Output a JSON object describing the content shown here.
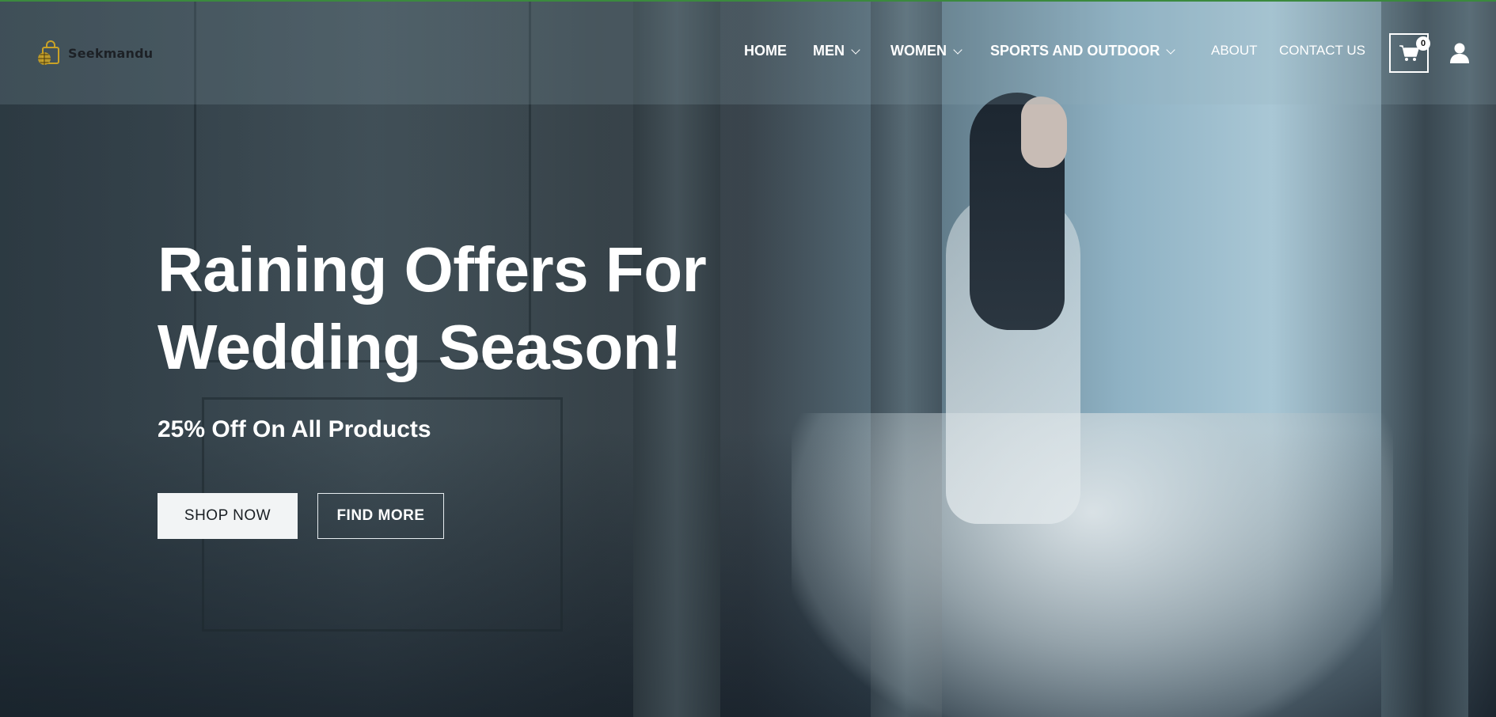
{
  "brand": {
    "name": "Seekmandu"
  },
  "nav": {
    "items": [
      {
        "label": "HOME",
        "dropdown": false
      },
      {
        "label": "MEN",
        "dropdown": true
      },
      {
        "label": "WOMEN",
        "dropdown": true
      },
      {
        "label": "SPORTS AND OUTDOOR",
        "dropdown": true
      },
      {
        "label": "ABOUT",
        "dropdown": false
      },
      {
        "label": "CONTACT US",
        "dropdown": false
      }
    ]
  },
  "cart": {
    "count": "0",
    "icon": "shopping-cart-icon"
  },
  "account": {
    "icon": "user-icon"
  },
  "hero": {
    "headline_line1": "Raining Offers For",
    "headline_line2": "Wedding Season!",
    "subheadline": "25% Off On All Products",
    "primary_button": "SHOP NOW",
    "secondary_button": "FIND MORE"
  },
  "colors": {
    "accent_border": "#3b8a3e",
    "logo_gold": "#c9a227",
    "button_light": "#f2f4f5"
  }
}
